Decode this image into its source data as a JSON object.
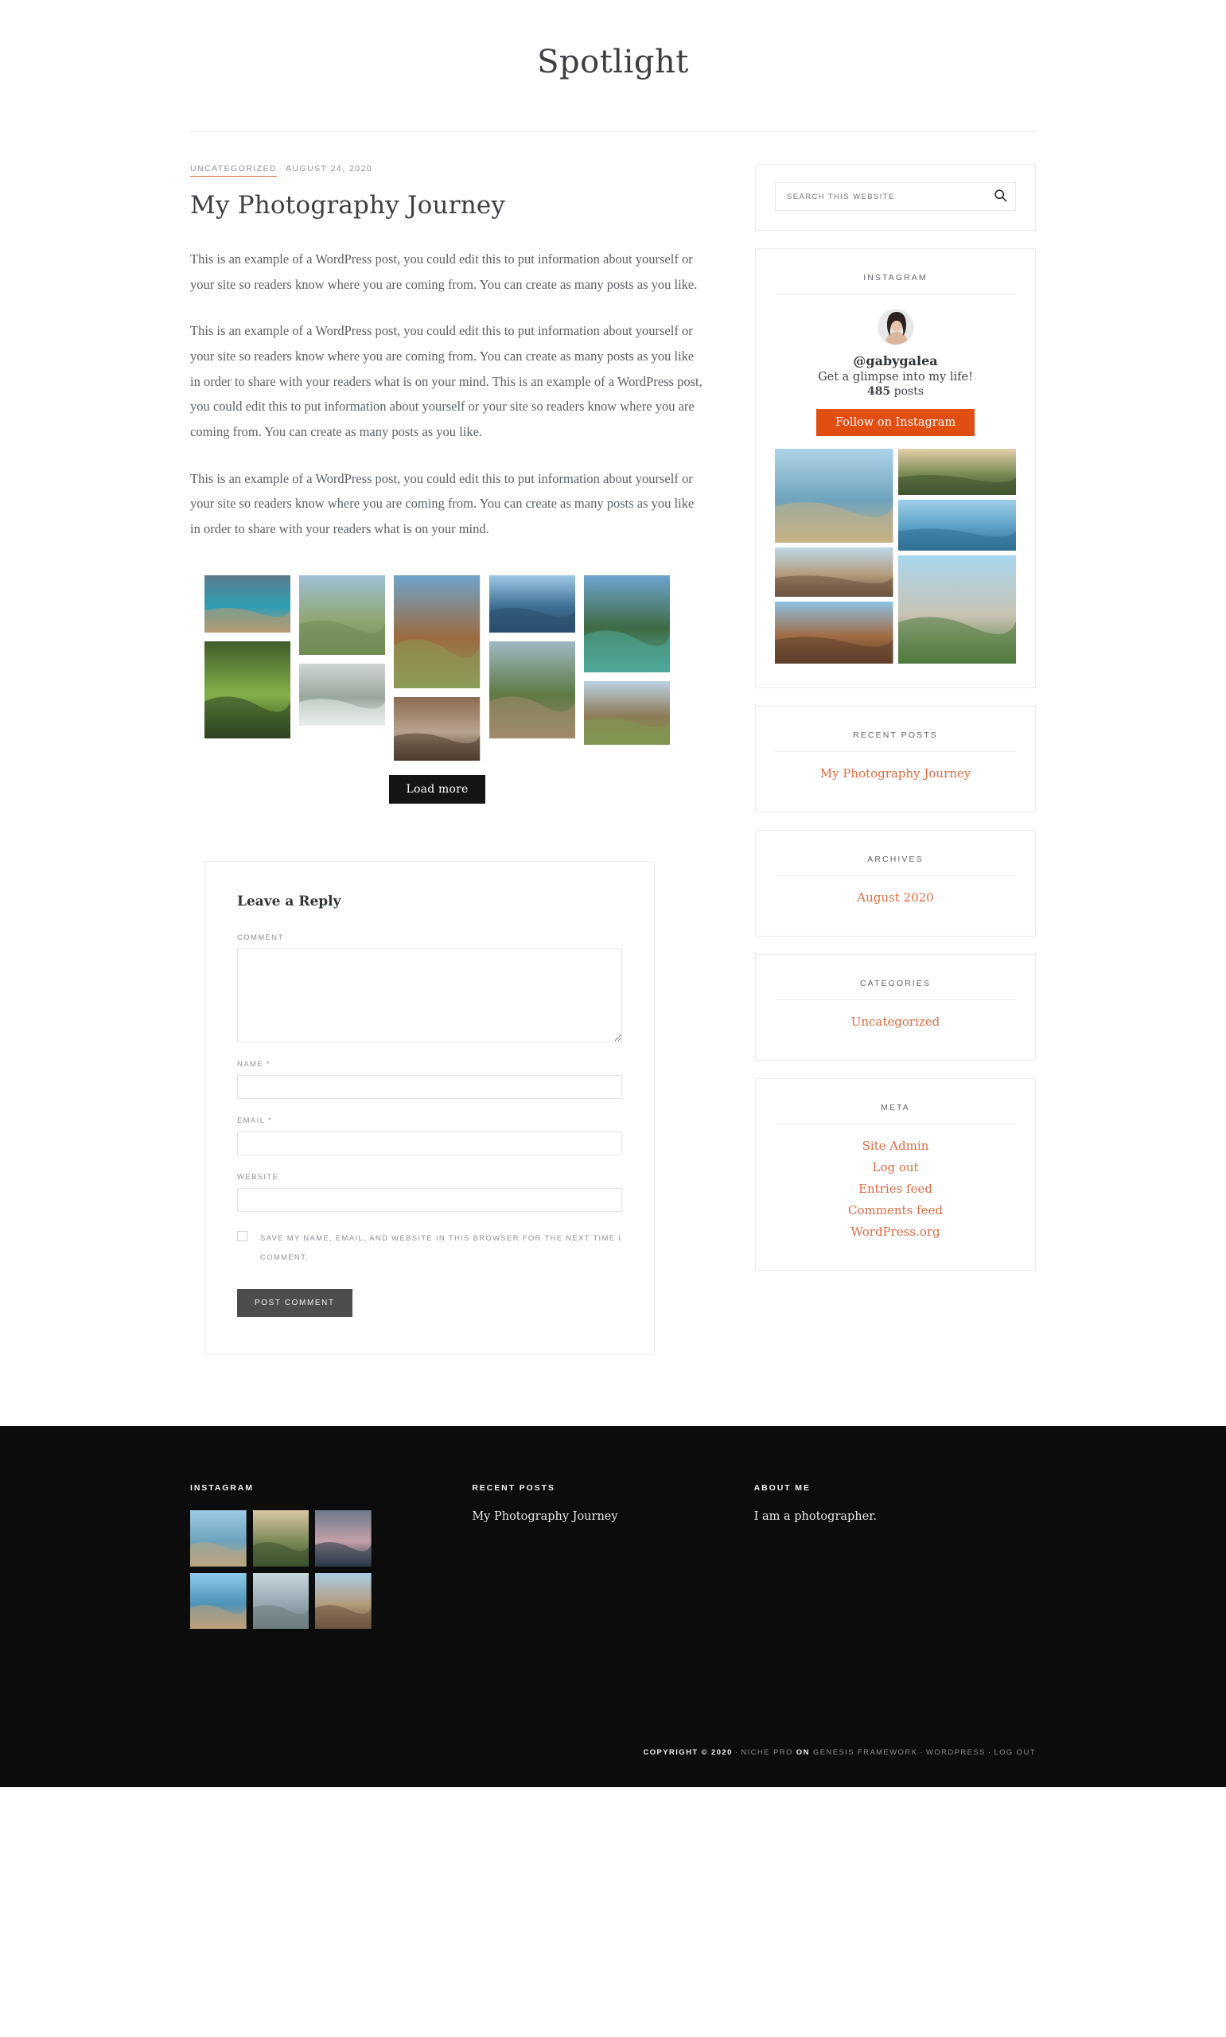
{
  "site": {
    "title": "Spotlight"
  },
  "post": {
    "category": "UNCATEGORIZED",
    "meta_separator": "·",
    "date": "AUGUST 24, 2020",
    "title": "My Photography Journey",
    "paragraphs": [
      "This is an example of a WordPress post, you could edit this to put information about yourself or your site so readers know where you are coming from. You can create as many posts as you like.",
      "This is an example of a WordPress post, you could edit this to put information about yourself or your site so readers know where you are coming from. You can create as many posts as you like in order to share with your readers what is on your mind. This is an example of a WordPress post, you could edit this to put information about yourself or your site so readers know where you are coming from. You can create as many posts as you like.",
      "This is an example of a WordPress post, you could edit this to put information about yourself or your site so readers know where you are coming from. You can create as many posts as you like in order to share with your readers what is on your mind."
    ],
    "load_more_label": "Load more"
  },
  "gallery": {
    "tiles": [
      {
        "alt": "turquoise-lagoon-photo",
        "h": 72,
        "c1": "#5a7b8c",
        "c2": "#2f9fb5",
        "c3": "#b59a74"
      },
      {
        "alt": "green-forest-canopy-photo",
        "h": 122,
        "c1": "#3f5c2a",
        "c2": "#86b04a",
        "c3": "#2c4420"
      },
      {
        "alt": "cactus-plant-photo",
        "h": 100,
        "c1": "#9fc0d8",
        "c2": "#8fa874",
        "c3": "#6f8a52"
      },
      {
        "alt": "frosted-branches-photo",
        "h": 78,
        "c1": "#cfd6d4",
        "c2": "#9aa79d",
        "c3": "#e8ece9"
      },
      {
        "alt": "autumn-park-path-photo",
        "h": 142,
        "c1": "#6fa4cc",
        "c2": "#9b6b3f",
        "c3": "#8d9a58"
      },
      {
        "alt": "waterfall-hikers-photo",
        "h": 80,
        "c1": "#8d6a52",
        "c2": "#b8a48e",
        "c3": "#4f3b2c"
      },
      {
        "alt": "blue-lake-cliffs-photo",
        "h": 72,
        "c1": "#9ec9e6",
        "c2": "#3f6f94",
        "c3": "#2a4d6c"
      },
      {
        "alt": "forest-trail-photo",
        "h": 122,
        "c1": "#9fb8c4",
        "c2": "#5d7a44",
        "c3": "#a08a6c"
      },
      {
        "alt": "mountain-river-photo",
        "h": 122,
        "c1": "#6ea4cf",
        "c2": "#3e6b44",
        "c3": "#4fa99a"
      },
      {
        "alt": "open-meadow-trees-photo",
        "h": 80,
        "c1": "#bcd2e2",
        "c2": "#8d7b58",
        "c3": "#7f9850"
      }
    ]
  },
  "comments": {
    "title": "Leave a Reply",
    "comment_label": "COMMENT",
    "comment_value": "",
    "name_label": "NAME",
    "name_required": "*",
    "name_value": "",
    "email_label": "EMAIL",
    "email_required": "*",
    "email_value": "",
    "website_label": "WEBSITE",
    "website_value": "",
    "cookie_consent": "Save my name, email, and website in this browser for the next time I comment.",
    "cookie_checked": false,
    "submit_label": "POST COMMENT"
  },
  "sidebar": {
    "search": {
      "placeholder": "SEARCH THIS WEBSITE",
      "value": "",
      "icon": "search-icon"
    },
    "instagram": {
      "title": "INSTAGRAM",
      "handle": "@gabygalea",
      "bio": "Get a glimpse into my life!",
      "posts_count": "485",
      "posts_word": "posts",
      "follow_label": "Follow on Instagram",
      "accent": "#e04e12",
      "photos": [
        {
          "alt": "beach-bay-cliff-photo",
          "c1": "#aed4e8",
          "c2": "#6fa3bd",
          "c3": "#c7b184"
        },
        {
          "alt": "hillside-sunset-photo",
          "c1": "#e2cfa8",
          "c2": "#7a8a52",
          "c3": "#3f5430"
        },
        {
          "alt": "coastal-town-sea-photo",
          "c1": "#9fd0ea",
          "c2": "#5a9ec4",
          "c3": "#2f6f93"
        },
        {
          "alt": "stone-alley-street-photo",
          "c1": "#bdd8ea",
          "c2": "#b59c7c",
          "c3": "#6e5440"
        },
        {
          "alt": "old-church-tower-photo",
          "c1": "#8fc2e4",
          "c2": "#a06c45",
          "c3": "#5e3f2c"
        },
        {
          "alt": "city-panorama-hill-photo",
          "c1": "#a8d6ee",
          "c2": "#c9c3b4",
          "c3": "#4f7a3c"
        }
      ]
    },
    "recent_posts": {
      "title": "RECENT POSTS",
      "items": [
        "My Photography Journey"
      ]
    },
    "archives": {
      "title": "ARCHIVES",
      "items": [
        "August 2020"
      ]
    },
    "categories": {
      "title": "CATEGORIES",
      "items": [
        "Uncategorized"
      ]
    },
    "meta": {
      "title": "META",
      "items": [
        "Site Admin",
        "Log out",
        "Entries feed",
        "Comments feed",
        "WordPress.org"
      ]
    }
  },
  "footer": {
    "instagram": {
      "title": "INSTAGRAM",
      "photos": [
        {
          "alt": "beach-bay-cliff-photo",
          "c1": "#9ecbe6",
          "c2": "#6fa3bd",
          "c3": "#b8a680"
        },
        {
          "alt": "hillside-sunset-photo",
          "c1": "#d9c9a4",
          "c2": "#7c8a55",
          "c3": "#3d5230"
        },
        {
          "alt": "dusk-island-sea-photo",
          "c1": "#6d7a8c",
          "c2": "#c4a0a8",
          "c3": "#2b3a4a"
        },
        {
          "alt": "coastal-cliff-blue-sky-photo",
          "c1": "#8ecbe9",
          "c2": "#4f93b8",
          "c3": "#c0a178"
        },
        {
          "alt": "overcast-seashore-photo",
          "c1": "#c9d6de",
          "c2": "#96a7b2",
          "c3": "#6d7b7e"
        },
        {
          "alt": "stone-alley-street-photo",
          "c1": "#a8cde6",
          "c2": "#b59c7c",
          "c3": "#6b5340"
        }
      ]
    },
    "recent_posts": {
      "title": "RECENT POSTS",
      "items": [
        "My Photography Journey"
      ]
    },
    "about": {
      "title": "ABOUT ME",
      "text": "I am a photographer."
    },
    "copyright": {
      "prefix": "COPYRIGHT © 2020",
      "sep1": "·",
      "theme": "NICHE PRO",
      "on": "ON",
      "framework": "GENESIS FRAMEWORK",
      "sep2": "·",
      "platform": "WORDPRESS",
      "sep3": "·",
      "logout": "LOG OUT"
    }
  }
}
